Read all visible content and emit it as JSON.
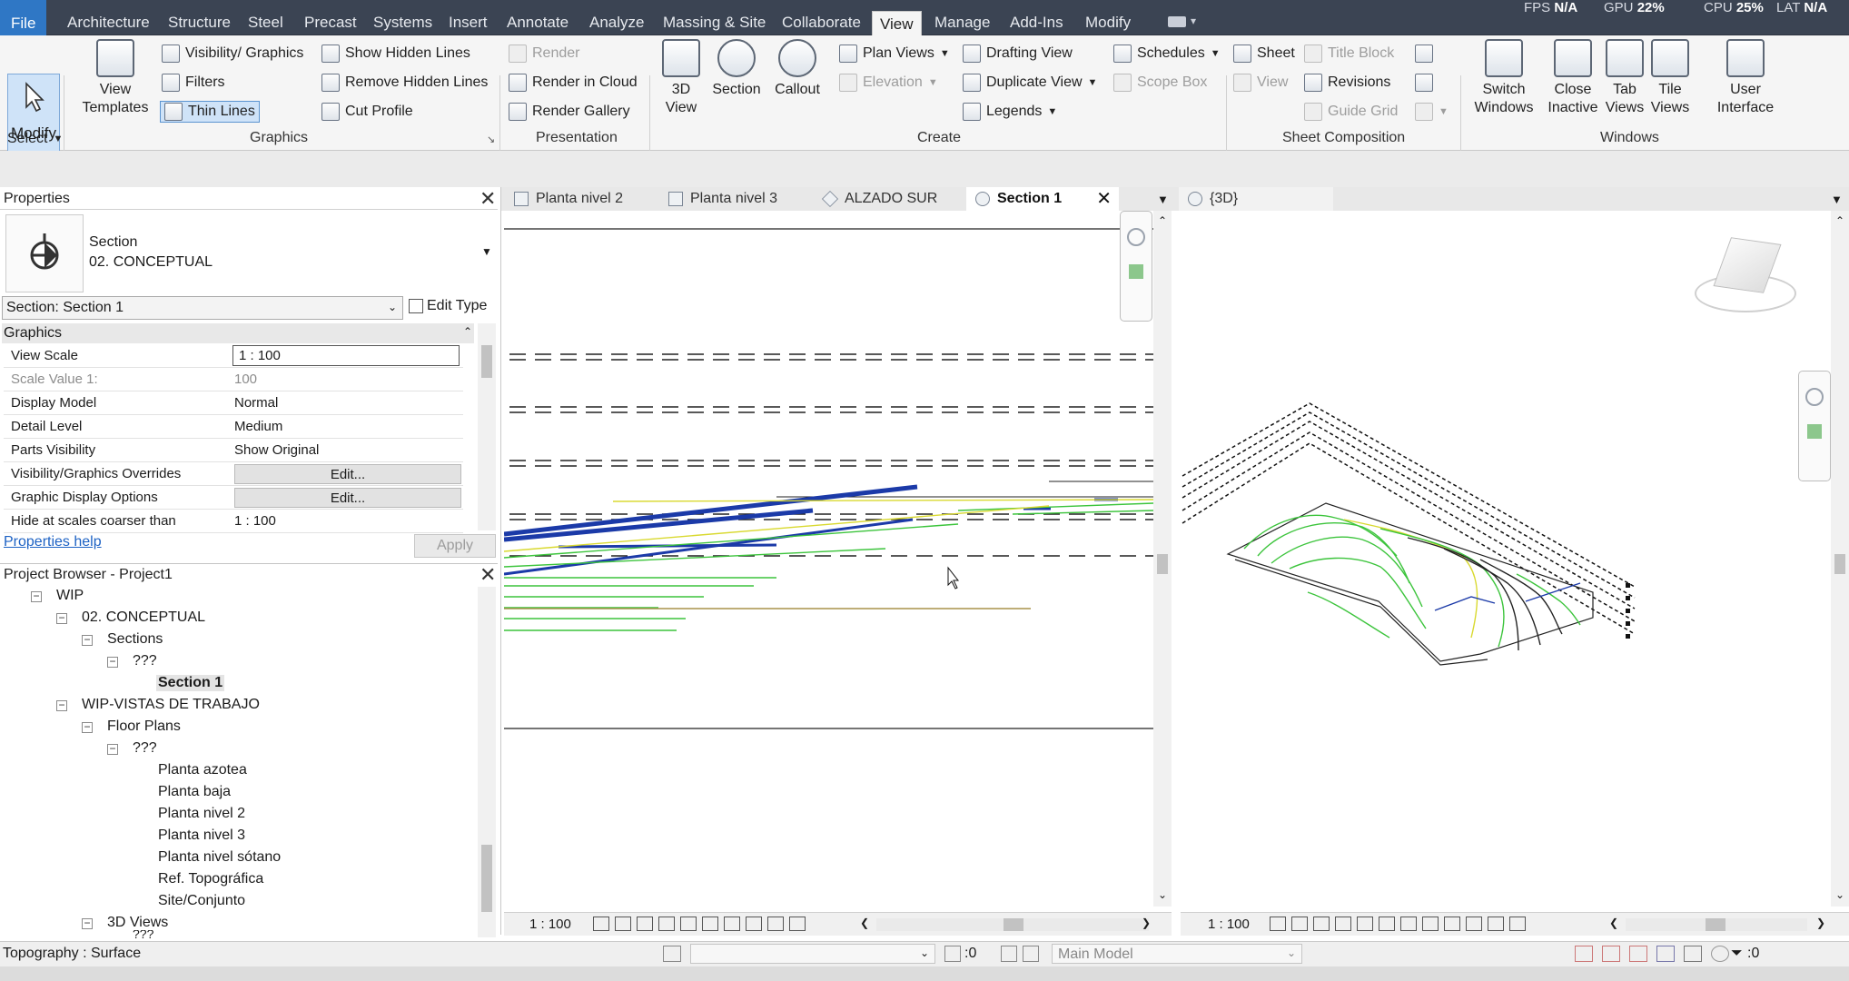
{
  "menubar": {
    "file": "File",
    "tabs": [
      "Architecture",
      "Structure",
      "Steel",
      "Precast",
      "Systems",
      "Insert",
      "Annotate",
      "Analyze",
      "Massing & Site",
      "Collaborate",
      "View",
      "Manage",
      "Add-Ins",
      "Modify"
    ],
    "active_tab": "View",
    "fps_label": "FPS",
    "fps_value": "N/A",
    "gpu_label": "GPU",
    "gpu_value": "22%",
    "cpu_label": "CPU",
    "cpu_value": "25%",
    "lat_label": "LAT",
    "lat_value": "N/A"
  },
  "ribbon": {
    "modify": "Modify",
    "select": "Select",
    "graphics": {
      "view_templates": "View Templates",
      "visibility_graphics": "Visibility/ Graphics",
      "filters": "Filters",
      "thin_lines": "Thin Lines",
      "show_hidden_lines": "Show Hidden Lines",
      "remove_hidden_lines": "Remove Hidden Lines",
      "cut_profile": "Cut Profile",
      "label": "Graphics"
    },
    "presentation": {
      "render": "Render",
      "render_cloud": "Render in Cloud",
      "render_gallery": "Render Gallery",
      "label": "Presentation"
    },
    "create": {
      "view_3d": "3D View",
      "section": "Section",
      "callout": "Callout",
      "plan_views": "Plan Views",
      "elevation": "Elevation",
      "drafting_view": "Drafting View",
      "duplicate_view": "Duplicate View",
      "legends": "Legends",
      "schedules": "Schedules",
      "scope_box": "Scope Box",
      "label": "Create"
    },
    "sheet": {
      "sheet": "Sheet",
      "title_block": "Title Block",
      "view": "View",
      "revisions": "Revisions",
      "guide_grid": "Guide Grid",
      "label": "Sheet Composition"
    },
    "windows": {
      "switch_windows": "Switch Windows",
      "close_inactive": "Close Inactive",
      "tab_views": "Tab Views",
      "tile_views": "Tile Views",
      "user_interface": "User Interface",
      "label": "Windows"
    }
  },
  "properties": {
    "title": "Properties",
    "type_family": "Section",
    "type_name": "02. CONCEPTUAL",
    "instance_selector": "Section: Section 1",
    "edit_type": "Edit Type",
    "group": "Graphics",
    "rows": [
      {
        "key": "View Scale",
        "value": "1 : 100"
      },
      {
        "key": "Scale Value    1:",
        "value": "100"
      },
      {
        "key": "Display Model",
        "value": "Normal"
      },
      {
        "key": "Detail Level",
        "value": "Medium"
      },
      {
        "key": "Parts Visibility",
        "value": "Show Original"
      },
      {
        "key": "Visibility/Graphics Overrides",
        "value": "Edit..."
      },
      {
        "key": "Graphic Display Options",
        "value": "Edit..."
      },
      {
        "key": "Hide at scales coarser than",
        "value": "1 : 100"
      }
    ],
    "help": "Properties help",
    "apply": "Apply"
  },
  "browser": {
    "title": "Project Browser - Project1",
    "items": [
      "WIP",
      "02. CONCEPTUAL",
      "Sections",
      "???",
      "Section 1",
      "WIP-VISTAS DE TRABAJO",
      "Floor Plans",
      "???",
      "Planta azotea",
      "Planta baja",
      "Planta nivel 2",
      "Planta nivel 3",
      "Planta nivel sótano",
      "Ref. Topográfica",
      "Site/Conjunto",
      "3D Views",
      "???"
    ]
  },
  "tabs": [
    "Planta nivel 2",
    "Planta nivel 3",
    "ALZADO SUR",
    "Section 1"
  ],
  "tab_3d": "{3D}",
  "section_view": {
    "scale": "1 : 100"
  },
  "view_3d": {
    "scale": "1 : 100"
  },
  "status": {
    "text": "Topography : Surface",
    "count": ":0",
    "model": "Main Model",
    "filter_count": ":0"
  },
  "colors": {
    "accent": "#2f77c5",
    "menubar": "#3b4453",
    "blue_line": "#1b3aa8",
    "green_line": "#3cc43c",
    "yellow_line": "#d9d930",
    "olive_line": "#a8924a"
  }
}
